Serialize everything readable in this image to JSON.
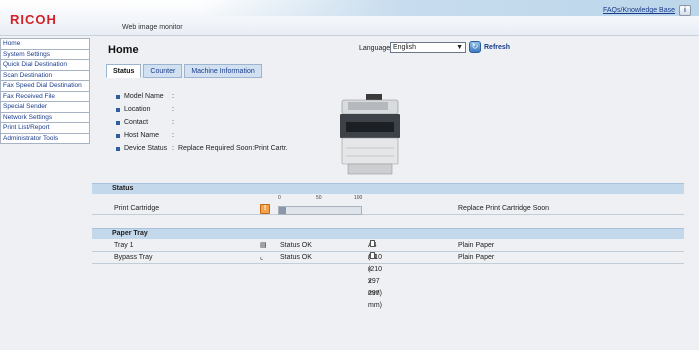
{
  "header": {
    "logo": "RICOH",
    "subtitle": "Web image monitor",
    "faq_link": "FAQs/Knowledge Base",
    "info_icon": "i"
  },
  "sidebar": {
    "items": [
      {
        "label": "Home"
      },
      {
        "label": "System Settings"
      },
      {
        "label": "Quick Dial Destination"
      },
      {
        "label": "Scan Destination"
      },
      {
        "label": "Fax Speed Dial Destination"
      },
      {
        "label": "Fax Received File"
      },
      {
        "label": "Special Sender"
      },
      {
        "label": "Network Settings"
      },
      {
        "label": "Print List/Report"
      },
      {
        "label": "Administrator Tools"
      }
    ]
  },
  "main": {
    "title": "Home",
    "language_label": "Language",
    "language_value": "English",
    "refresh_label": "Refresh",
    "tabs": [
      {
        "label": "Status",
        "active": true
      },
      {
        "label": "Counter",
        "active": false
      },
      {
        "label": "Machine Information",
        "active": false
      }
    ],
    "info": [
      {
        "label": "Model Name",
        "value": ""
      },
      {
        "label": "Location",
        "value": ""
      },
      {
        "label": "Contact",
        "value": ""
      },
      {
        "label": "Host Name",
        "value": ""
      },
      {
        "label": "Device Status",
        "value": "Replace Required Soon:Print Cartr."
      }
    ]
  },
  "status_section": {
    "title": "Status",
    "scale_labels": [
      "0",
      "50",
      "100"
    ],
    "print_cartridge": {
      "label": "Print Cartridge",
      "level_percent": 8,
      "message": "Replace Print Cartridge Soon"
    }
  },
  "paper_section": {
    "title": "Paper Tray",
    "trays": [
      {
        "name": "Tray 1",
        "status": "Status OK",
        "size": "A4 (210 x 297 mm)",
        "type": "Plain Paper"
      },
      {
        "name": "Bypass Tray",
        "status": "Status OK",
        "size": "A4 (210 x 297 mm)",
        "type": "Plain Paper"
      }
    ]
  },
  "colors": {
    "brand": "#d2232a",
    "link": "#1a3c8c",
    "section_header": "#c4d8ec",
    "alert": "#f1a24a"
  }
}
